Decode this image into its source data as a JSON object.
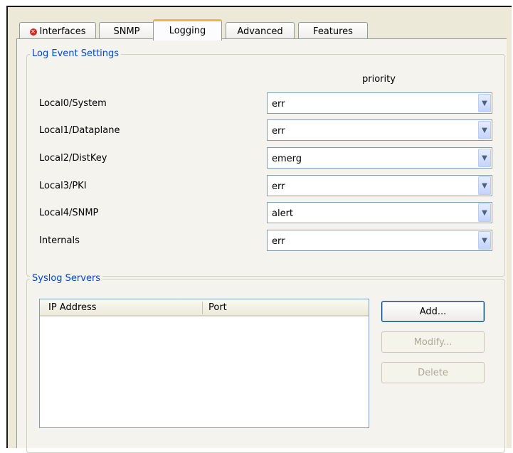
{
  "tabs": [
    {
      "label": "Interfaces",
      "error_icon": "error-icon"
    },
    {
      "label": "SNMP"
    },
    {
      "label": "Logging",
      "active": true
    },
    {
      "label": "Advanced"
    },
    {
      "label": "Features"
    }
  ],
  "log_event_settings": {
    "title": "Log Event Settings",
    "priority_header": "priority",
    "rows": [
      {
        "label": "Local0/System",
        "value": "err"
      },
      {
        "label": "Local1/Dataplane",
        "value": "err"
      },
      {
        "label": "Local2/DistKey",
        "value": "emerg"
      },
      {
        "label": "Local3/PKI",
        "value": "err"
      },
      {
        "label": "Local4/SNMP",
        "value": "alert"
      },
      {
        "label": "Internals",
        "value": "err"
      }
    ]
  },
  "syslog_servers": {
    "title": "Syslog Servers",
    "columns": [
      "IP Address",
      "Port"
    ],
    "buttons": {
      "add": "Add...",
      "modify": "Modify...",
      "delete": "Delete"
    }
  }
}
